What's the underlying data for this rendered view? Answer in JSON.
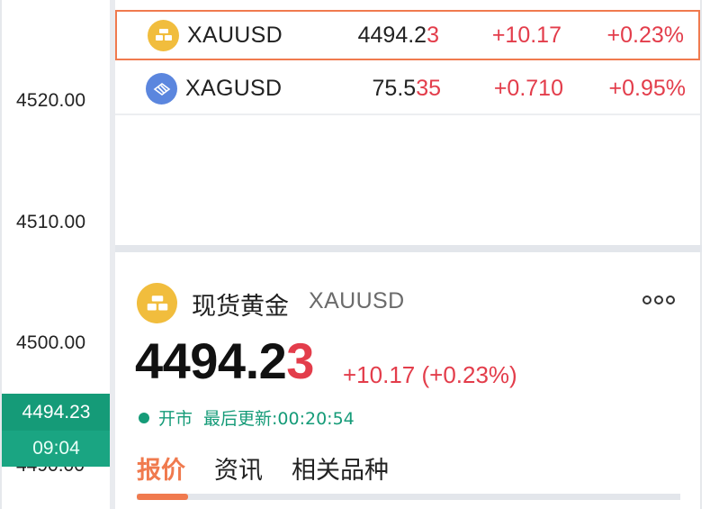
{
  "axis": {
    "labels": [
      "4520.00",
      "4510.00",
      "4500.00"
    ],
    "hidden_label": "4490.00",
    "cursor_price": "4494.23",
    "cursor_time": "09:04"
  },
  "watchlist": [
    {
      "symbol": "XAUUSD",
      "price_main": "4494.2",
      "price_tail": "3",
      "change": "+10.17",
      "percent": "+0.23%",
      "icon": "gold-bar-icon",
      "selected": true
    },
    {
      "symbol": "XAGUSD",
      "price_main": "75.5",
      "price_tail": "35",
      "change": "+0.710",
      "percent": "+0.95%",
      "icon": "silver-bars-icon",
      "selected": false
    }
  ],
  "detail": {
    "name_cn": "现货黄金",
    "code": "XAUUSD",
    "price_main": "4494.2",
    "price_tail": "3",
    "change_text": "+10.17 (+0.23%)",
    "status_label": "开市",
    "updated_text": "最后更新:00:20:54",
    "tabs": [
      "报价",
      "资讯",
      "相关品种"
    ],
    "active_tab": 0,
    "icon": "gold-bar-icon",
    "more_icon": "more-options-icon"
  },
  "colors": {
    "accent": "#f07a4e",
    "up": "#e33d4b",
    "green": "#159b78",
    "gold": "#f1bd3d",
    "silver": "#5b86de"
  }
}
